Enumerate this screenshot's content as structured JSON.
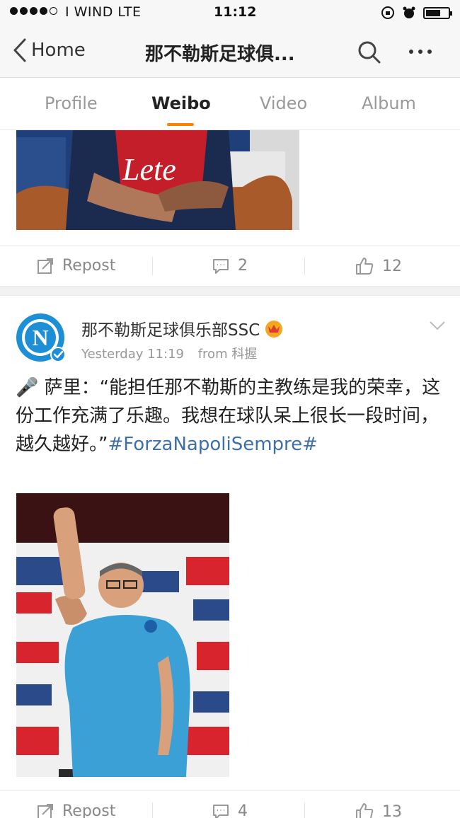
{
  "status_bar": {
    "carrier": "I WIND   LTE",
    "time": "11:12",
    "signal_bars_filled": 4,
    "signal_bars_total": 5,
    "battery_level": 0.65
  },
  "nav": {
    "back_label": "Home",
    "title": "那不勒斯足球俱..."
  },
  "tabs": [
    {
      "label": "Profile",
      "active": false
    },
    {
      "label": "Weibo",
      "active": true
    },
    {
      "label": "Video",
      "active": false
    },
    {
      "label": "Album",
      "active": false
    }
  ],
  "colors": {
    "accent": "#ff8200",
    "hashtag": "#3f6fa8",
    "napoli_blue": "#1d8fd6"
  },
  "posts": [
    {
      "image_alt": "Napoli player in Lete shirt seated",
      "actions": {
        "repost_label": "Repost",
        "comments": "2",
        "likes": "12"
      }
    },
    {
      "author": "那不勒斯足球俱乐部SSC",
      "timestamp": "Yesterday 11:19",
      "source": "from 科握",
      "text_prefix": "🎤 萨里：“能担任那不勒斯的主教练是我的荣幸，这份工作充满了乐趣。我想在球队呆上很长一段时间，越久越好。”",
      "hashtag": "#ForzaNapoliSempre#",
      "actions": {
        "repost_label": "Repost",
        "comments": "4",
        "likes": "13"
      }
    }
  ]
}
